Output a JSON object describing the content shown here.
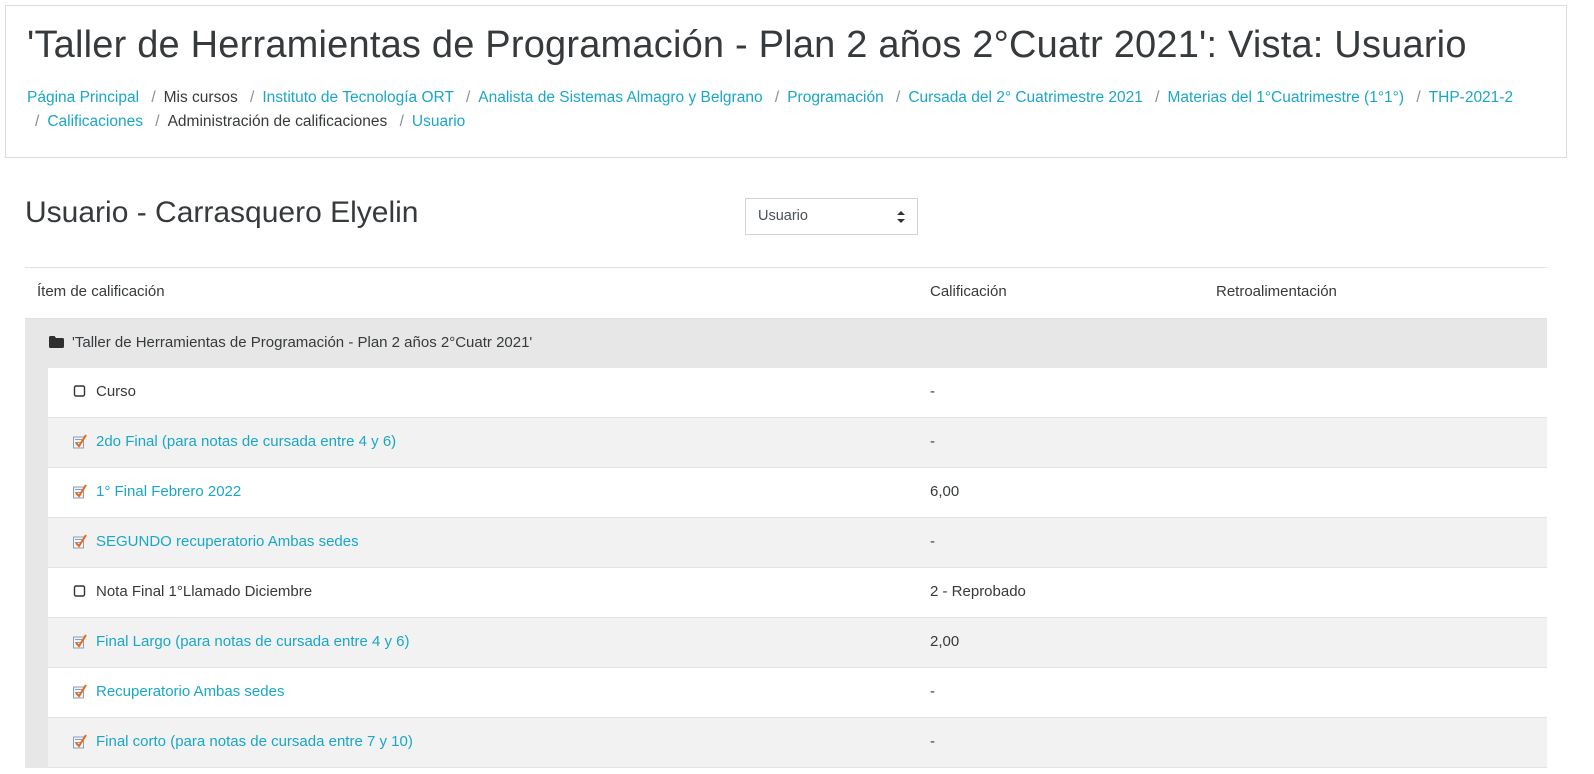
{
  "header": {
    "title": "'Taller de Herramientas de Programación - Plan 2 años 2°Cuatr 2021': Vista: Usuario",
    "breadcrumb": [
      {
        "label": "Página Principal",
        "link": true
      },
      {
        "label": "Mis cursos",
        "link": false
      },
      {
        "label": "Instituto de Tecnología ORT",
        "link": true
      },
      {
        "label": "Analista de Sistemas Almagro y Belgrano",
        "link": true
      },
      {
        "label": "Programación",
        "link": true
      },
      {
        "label": "Cursada del 2° Cuatrimestre 2021",
        "link": true
      },
      {
        "label": "Materias del 1°Cuatrimestre (1°1°)",
        "link": true
      },
      {
        "label": "THP-2021-2",
        "link": true
      },
      {
        "label": "Calificaciones",
        "link": true
      },
      {
        "label": "Administración de calificaciones",
        "link": false
      },
      {
        "label": "Usuario",
        "link": true
      }
    ]
  },
  "report": {
    "user_heading": "Usuario - Carrasquero Elyelin",
    "view_select": {
      "selected": "Usuario"
    }
  },
  "table": {
    "columns": [
      "Ítem de calificación",
      "Calificación",
      "Retroalimentación"
    ],
    "category": {
      "label": "'Taller de Herramientas de Programación - Plan 2 años 2°Cuatr 2021'",
      "icon": "folder-icon"
    },
    "rows": [
      {
        "item": "Curso",
        "grade": "-",
        "feedback": "",
        "icon": "checkbox-icon",
        "link": false
      },
      {
        "item": "2do Final (para notas de cursada entre 4 y 6)",
        "grade": "-",
        "feedback": "",
        "icon": "assignment-icon",
        "link": true
      },
      {
        "item": "1° Final Febrero 2022",
        "grade": "6,00",
        "feedback": "",
        "icon": "assignment-icon",
        "link": true
      },
      {
        "item": "SEGUNDO recuperatorio Ambas sedes",
        "grade": "-",
        "feedback": "",
        "icon": "assignment-icon",
        "link": true
      },
      {
        "item": "Nota Final 1°Llamado Diciembre",
        "grade": "2 - Reprobado",
        "feedback": "",
        "icon": "checkbox-icon",
        "link": false
      },
      {
        "item": "Final Largo (para notas de cursada entre 4 y 6)",
        "grade": "2,00",
        "feedback": "",
        "icon": "assignment-icon",
        "link": true
      },
      {
        "item": "Recuperatorio Ambas sedes",
        "grade": "-",
        "feedback": "",
        "icon": "assignment-icon",
        "link": true
      },
      {
        "item": "Final corto (para notas de cursada entre 7 y 10)",
        "grade": "-",
        "feedback": "",
        "icon": "assignment-icon",
        "link": true
      }
    ]
  },
  "colors": {
    "link": "#1aa7c7",
    "text": "#373a3c",
    "category_bg": "#e7e7e7"
  }
}
